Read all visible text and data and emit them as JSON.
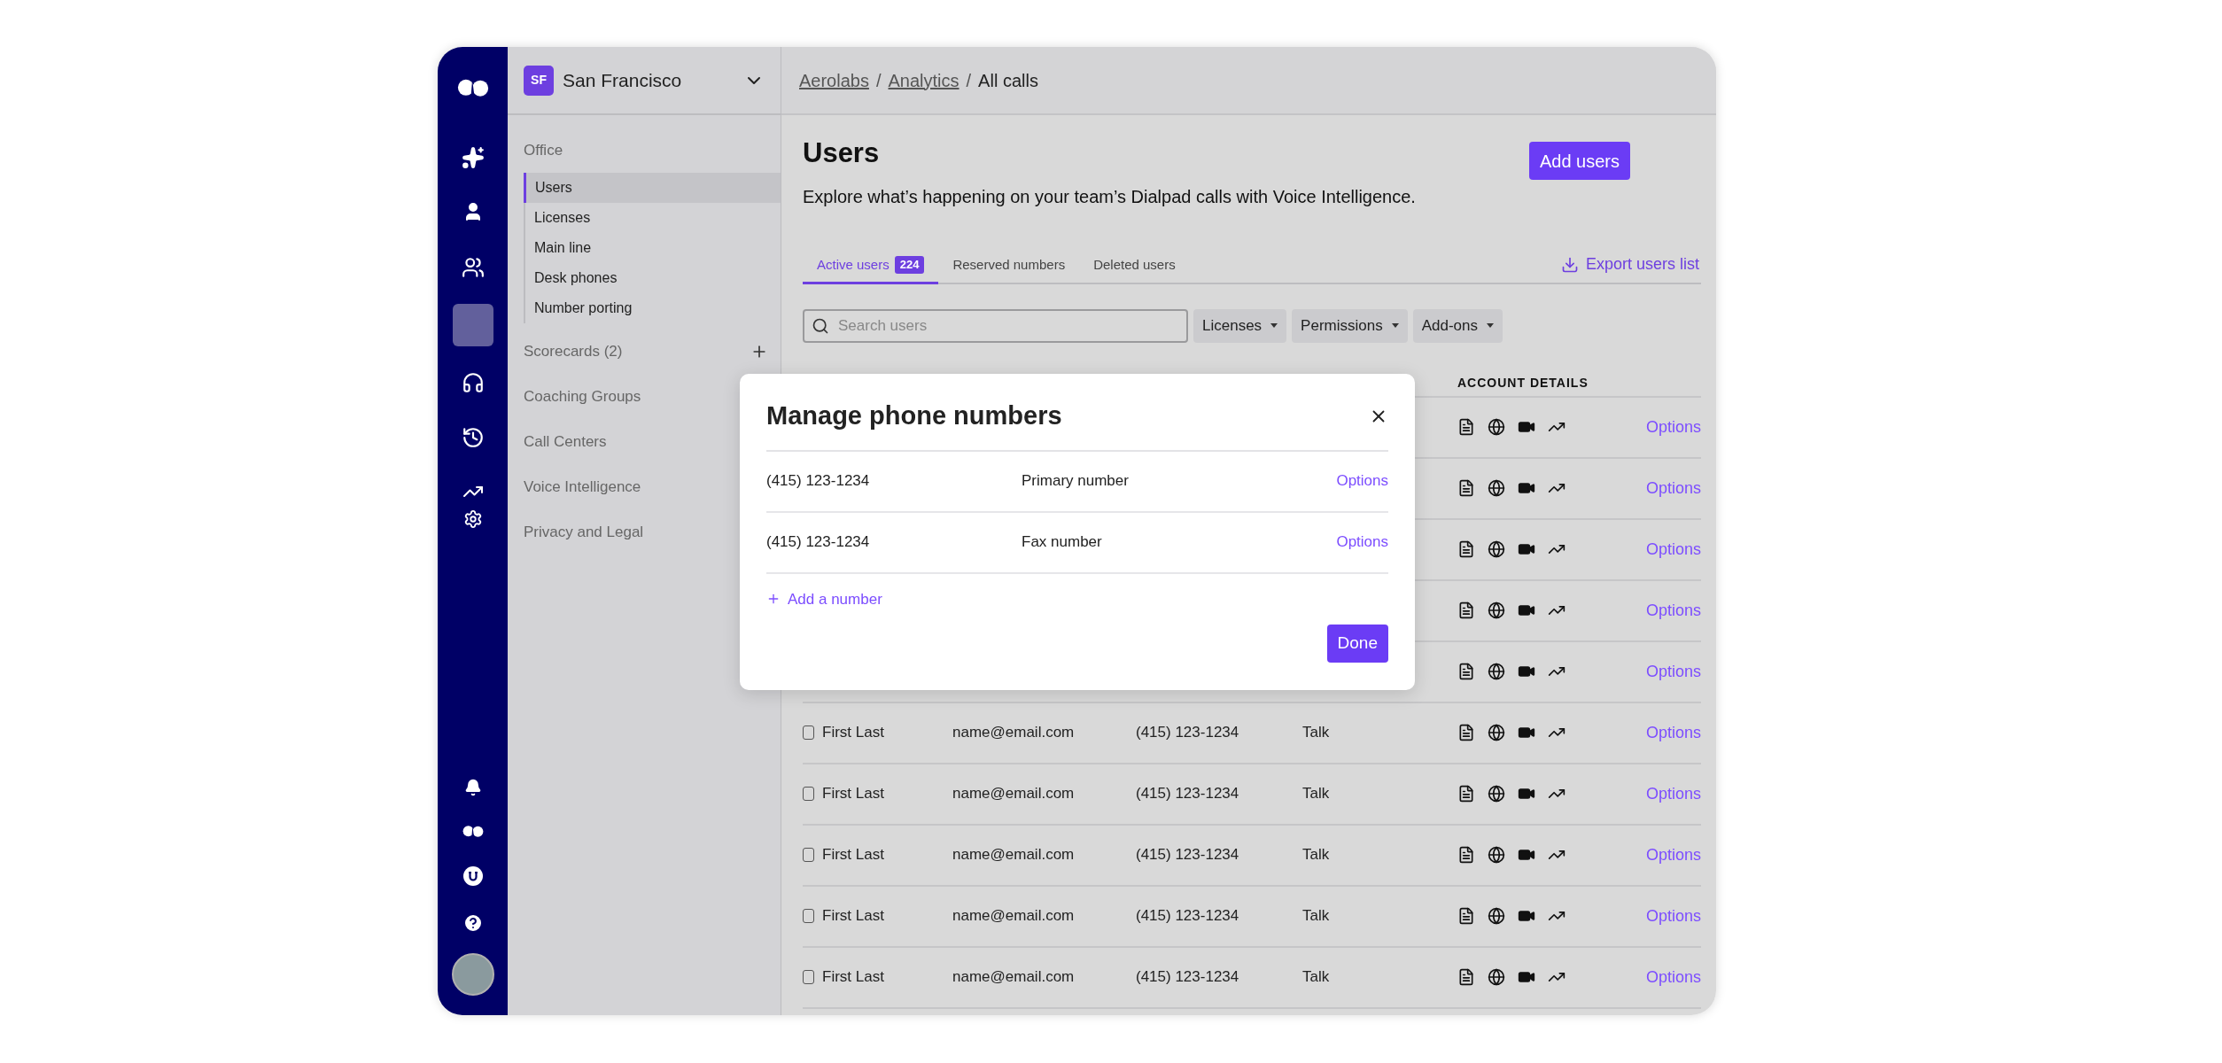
{
  "workspace": {
    "badge": "SF",
    "name": "San Francisco"
  },
  "breadcrumb": [
    {
      "kind": "link",
      "label": "Aerolabs"
    },
    {
      "kind": "separator",
      "label": "/"
    },
    {
      "kind": "link",
      "label": "Analytics"
    },
    {
      "kind": "separator",
      "label": "/"
    },
    {
      "kind": "current",
      "label": "All calls"
    }
  ],
  "sidebar": {
    "sections": [
      {
        "label": "Office",
        "children": [
          {
            "label": "Users",
            "selected": true
          },
          {
            "label": "Licenses",
            "selected": false
          },
          {
            "label": "Main line",
            "selected": false
          },
          {
            "label": "Desk phones",
            "selected": false
          },
          {
            "label": "Number porting",
            "selected": false
          }
        ]
      },
      {
        "label": "Scorecards (2)",
        "addable": true
      },
      {
        "label": "Coaching Groups"
      },
      {
        "label": "Call Centers"
      },
      {
        "label": "Voice Intelligence"
      },
      {
        "label": "Privacy and Legal"
      }
    ]
  },
  "page": {
    "title": "Users",
    "description": "Explore what’s happening on your team’s Dialpad calls with Voice Intelligence.",
    "primary_button": "Add users"
  },
  "tabs": [
    {
      "label": "Active users",
      "count": "224",
      "selected": true
    },
    {
      "label": "Reserved numbers",
      "selected": false
    },
    {
      "label": "Deleted users",
      "selected": false
    }
  ],
  "export_link": "Export users list",
  "search": {
    "placeholder": "Search users"
  },
  "filters": [
    "Licenses",
    "Permissions",
    "Add-ons"
  ],
  "table": {
    "columns": [
      {
        "label": "ACCOUNT DETAILS"
      }
    ],
    "rows": [
      {
        "options": "Options"
      },
      {
        "options": "Options"
      },
      {
        "options": "Options"
      },
      {
        "options": "Options"
      },
      {
        "options": "Options"
      },
      {
        "checked": false,
        "name": "First Last",
        "email": "name@email.com",
        "phone": "(415) 123-1234",
        "plan": "Talk",
        "options": "Options"
      },
      {
        "checked": false,
        "name": "First Last",
        "email": "name@email.com",
        "phone": "(415) 123-1234",
        "plan": "Talk",
        "options": "Options"
      },
      {
        "checked": false,
        "name": "First Last",
        "email": "name@email.com",
        "phone": "(415) 123-1234",
        "plan": "Talk",
        "options": "Options"
      },
      {
        "checked": false,
        "name": "First Last",
        "email": "name@email.com",
        "phone": "(415) 123-1234",
        "plan": "Talk",
        "options": "Options"
      },
      {
        "checked": false,
        "name": "First Last",
        "email": "name@email.com",
        "phone": "(415) 123-1234",
        "plan": "Talk",
        "options": "Options"
      }
    ]
  },
  "modal": {
    "title": "Manage phone numbers",
    "numbers": [
      {
        "number": "(415) 123-1234",
        "type": "Primary number",
        "action": "Options"
      },
      {
        "number": "(415) 123-1234",
        "type": "Fax number",
        "action": "Options"
      }
    ],
    "add_link": "Add a number",
    "done_button": "Done"
  }
}
